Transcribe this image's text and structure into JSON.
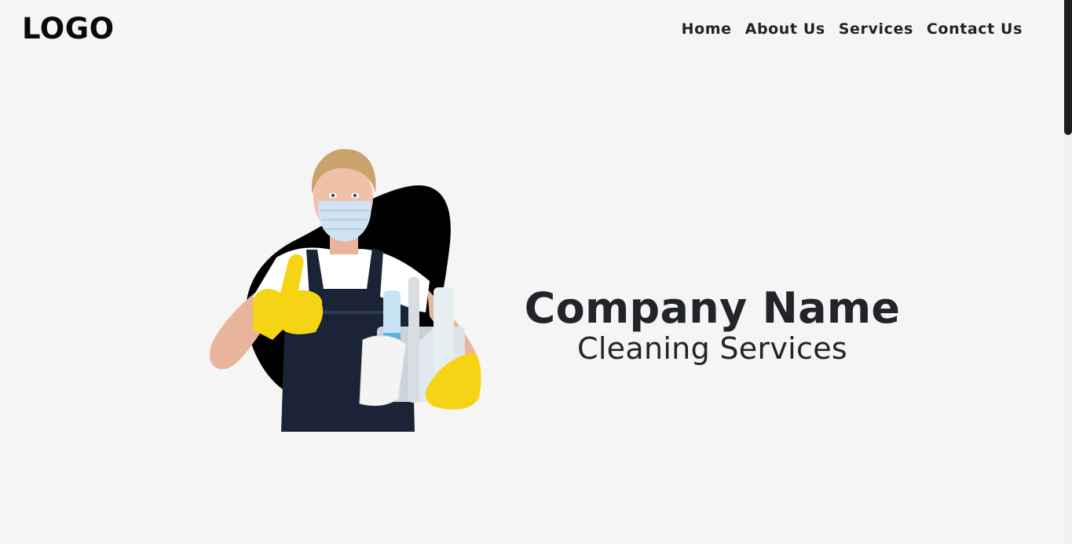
{
  "header": {
    "logo_text": "LOGO",
    "nav": [
      {
        "label": "Home"
      },
      {
        "label": "About Us"
      },
      {
        "label": "Services"
      },
      {
        "label": "Contact Us"
      }
    ]
  },
  "hero": {
    "title": "Company Name",
    "subtitle": "Cleaning Services",
    "image_subject": "cleaner-with-supplies-illustration"
  },
  "colors": {
    "background": "#f5f5f5",
    "text": "#212529",
    "blob": "#000000",
    "glove": "#f5d315",
    "apron": "#1b2436"
  }
}
